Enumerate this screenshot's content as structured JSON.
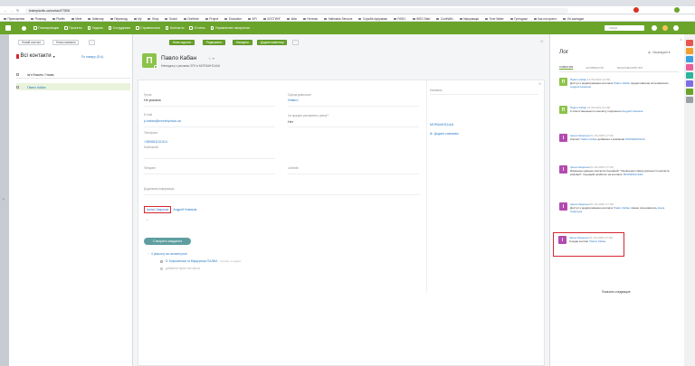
{
  "browser": {
    "url": "teslerplanfix.ua/contact/77808",
    "bookmarks": [
      "Приложения",
      "Розклад",
      "Planfix",
      "Meet",
      "Київстар",
      "Переклад",
      "My",
      "Shop",
      "Social",
      "OneNote",
      "Project",
      "Education",
      "API",
      "ХОСТИНГ",
      "Київ",
      "Нотатки",
      "Hallmarks Sensors",
      "Служба підтримки",
      "FASIC",
      "WSO Start",
      "CodeWiki",
      "Інформація",
      "Tone Water",
      "Гуглодоки",
      "Как построить",
      "Усі закладки"
    ]
  },
  "nav": {
    "items": [
      "Планировщик",
      "Проекты",
      "Задачи",
      "Сотрудники",
      "Справочники",
      "Контакты",
      "Отчеты",
      "Управление аккаунтом"
    ],
    "search_placeholder": "пошук"
  },
  "list": {
    "new_contact": "Новий контакт",
    "new_company": "Нова компанія",
    "title": "Всі контакти",
    "sort": "По номеру (Я-А)",
    "header": "Ім'я Фамілія / Назва",
    "items": [
      {
        "name": "Павло Кабан"
      }
    ]
  },
  "toolbar": {
    "buttons": [
      "Нове зад-ння",
      "Редагувати",
      "Нагадати",
      "Додати коментар"
    ]
  },
  "contact": {
    "avatar_letter": "П",
    "name": "Павло Кабан",
    "subtitle": "Менеджер з реклами ЗПУ в МОРШИНСЬКА",
    "fields": {
      "group_label": "Група",
      "group": "Не указана",
      "sphere_label": "Сфера діяльності",
      "sphere": "Инвест",
      "email_label": "E-mail",
      "email": "p.kaban@morshynska.ua",
      "ad_label": "Чи працює рекламного ринку?",
      "ad": "Нет",
      "phones_label": "Телефони",
      "phone": "+380681131314",
      "phone_type": "Мобільний",
      "telegram_label": "Telegram",
      "linkedin_label": "LinkedIn",
      "extra_label": "Додаткова інформація",
      "dash": "—"
    },
    "assignees": [
      "Ірина Сварська",
      "Андрей Новиков"
    ],
    "company_label": "Компанія",
    "company": "МОРШИНСЬКА",
    "add_company": "Додати компанію",
    "create_task": "Створити завдання",
    "tasks_header": "4 (всього) всі активні ролі",
    "tasks": [
      {
        "text": "Є: Моршинська та Вірщерська ПАЛМА",
        "note": "Контакт в задачі"
      },
      {
        "text": "добавити пункт чек-листа"
      }
    ]
  },
  "log": {
    "title": "Лог",
    "filter": "Сворткурсії",
    "tabs": [
      "СОБЫТИЯ",
      "АКТИВНОСТЬ",
      "ТЕХНИЧЕСКИЙ ЛОГ"
    ],
    "entries": [
      {
        "letter": "П",
        "color": "#8bc34a",
        "author": "Павло Кабан",
        "time": "13-06-2024 (11:09)",
        "line1": "Доступ к редагированию контакта",
        "link1": "Павло Кабан",
        "line2": "предоставлена пользователю",
        "link2": "Андрей Новиков"
      },
      {
        "letter": "П",
        "color": "#8bc34a",
        "author": "Павло Кабан",
        "time": "13-06-2024 (11:09)",
        "line1": "К ответственным по контакту подключен",
        "link1": "Андрей Новиков",
        "line2": "",
        "link2": ""
      },
      {
        "letter": "І",
        "color": "#b24bb0",
        "author": "Ірина Сварська",
        "time": "01-04-2025 (17:33)",
        "line1": "Контакт",
        "link1": "Павло Кабан",
        "line2": "добавлен к компании",
        "link2": "МОРШИНСЬКА"
      },
      {
        "letter": "І",
        "color": "#b24bb0",
        "author": "Ірина Сварська",
        "time": "01-04-2025 (17:33)",
        "line1": "Изменены данные контакта",
        "link1": "",
        "line2": "Сценарий: \"Оновлення сфери діяльності контакта компанії\". Сценарій сработал на контакте",
        "link2": "МОРШИНСЬКА"
      },
      {
        "letter": "І",
        "color": "#b24bb0",
        "author": "Ірина Сварська",
        "time": "01-04-2025 (17:33)",
        "line1": "Доступ к редагированию контакта",
        "link1": "Павло Кабан",
        "line2": "лишен пользователь",
        "link2": "Ірина Сварська"
      },
      {
        "letter": "І",
        "color": "#b24bb0",
        "author": "Ірина Сварська",
        "time": "01-04-2025 (17:33)",
        "line1": "Создан контакт",
        "link1": "Павло Кабан",
        "line2": "",
        "link2": ""
      }
    ],
    "more": "Показать следующие"
  },
  "right_icons": [
    "#e8554e",
    "#f0a030",
    "#3aa0e0",
    "#e85f9a",
    "#2bb59d",
    "#7c6fe0",
    "#6aa42b",
    "#9aa0a6"
  ]
}
